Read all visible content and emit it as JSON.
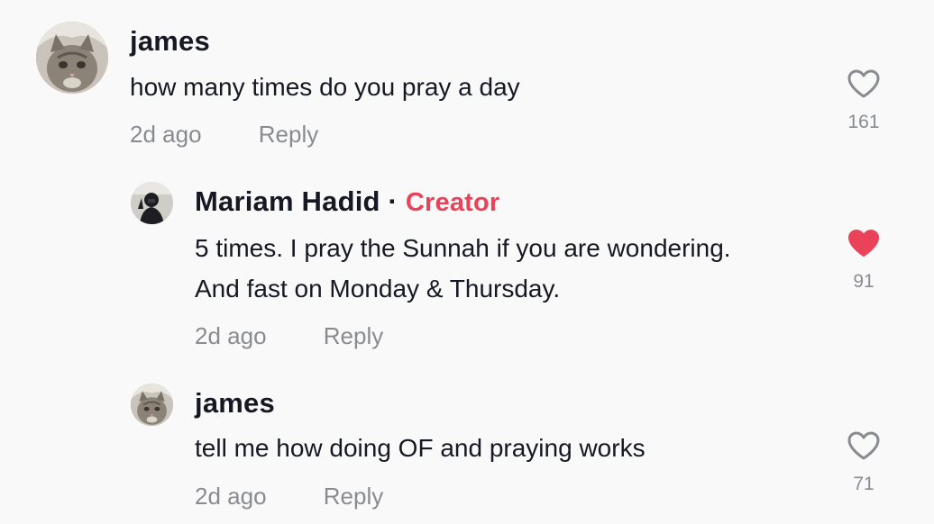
{
  "comments": [
    {
      "username": "james",
      "text": "how many times do you pray a day",
      "time": "2d ago",
      "reply": "Reply",
      "likes": "161",
      "liked": false
    },
    {
      "username": "Mariam Hadid",
      "creator_sep": "·",
      "creator_label": "Creator",
      "text_line1": "5 times. I pray the Sunnah if you are wondering.",
      "text_line2": "And fast on Monday & Thursday.",
      "time": "2d ago",
      "reply": "Reply",
      "likes": "91",
      "liked": true
    },
    {
      "username": "james",
      "text": "tell me how doing OF and praying works",
      "time": "2d ago",
      "reply": "Reply",
      "likes": "71",
      "liked": false
    }
  ],
  "colors": {
    "accent": "#ea4359",
    "text": "#161823",
    "muted": "#8a8b91",
    "background": "#f9f9f9"
  },
  "icons": {
    "like_outline": "heart-outline-icon",
    "like_filled": "heart-filled-icon",
    "avatar_cat": "cat-avatar",
    "avatar_person": "person-avatar"
  }
}
